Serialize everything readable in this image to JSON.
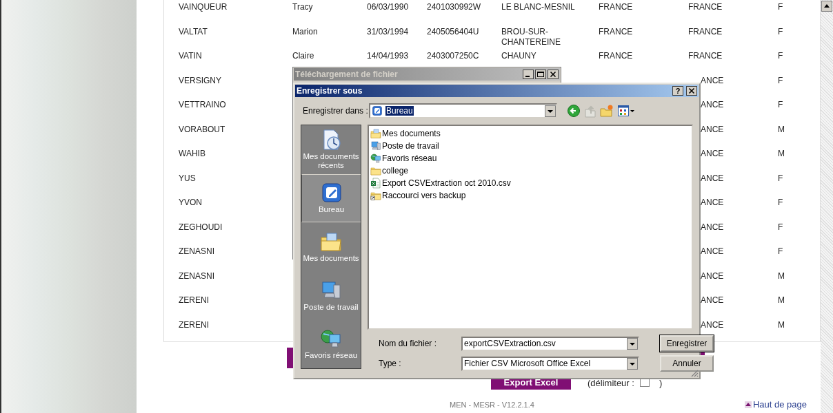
{
  "table": {
    "rows": [
      {
        "kind": "full",
        "cells": [
          "VAINQUEUR",
          "Tracy",
          "06/03/1990",
          "2401030992W",
          "LE BLANC-MESNIL",
          "FRANCE",
          "FRANCE",
          "F"
        ]
      },
      {
        "kind": "full",
        "cells": [
          "VALTAT",
          "Marion",
          "31/03/1994",
          "2405056404U",
          "BROU-SUR-CHANTEREINE",
          "FRANCE",
          "FRANCE",
          "F"
        ]
      },
      {
        "kind": "full",
        "cells": [
          "VATIN",
          "Claire",
          "14/04/1993",
          "2403007250C",
          "CHAUNY",
          "FRANCE",
          "FRANCE",
          "F"
        ]
      },
      {
        "kind": "covered",
        "cells": [
          "VERSIGNY",
          "ANCE",
          "F"
        ]
      },
      {
        "kind": "covered",
        "cells": [
          "VETTRAINO",
          "ANCE",
          "F"
        ]
      },
      {
        "kind": "covered",
        "cells": [
          "VORABOUT",
          "ANCE",
          "M"
        ]
      },
      {
        "kind": "covered",
        "cells": [
          "WAHIB",
          "ANCE",
          "M"
        ]
      },
      {
        "kind": "covered",
        "cells": [
          "YUS",
          "ANCE",
          "F"
        ]
      },
      {
        "kind": "covered",
        "cells": [
          "YVON",
          "ANCE",
          "F"
        ]
      },
      {
        "kind": "covered",
        "cells": [
          "ZEGHOUDI",
          "ANCE",
          "F"
        ]
      },
      {
        "kind": "covered",
        "cells": [
          "ZENASNI",
          "ANCE",
          "F"
        ]
      },
      {
        "kind": "covered",
        "cells": [
          "ZENASNI",
          "ANCE",
          "M"
        ]
      },
      {
        "kind": "covered",
        "cells": [
          "ZERENI",
          "ANCE",
          "M"
        ]
      },
      {
        "kind": "covered",
        "cells": [
          "ZERENI",
          "ANCE",
          "M"
        ]
      }
    ]
  },
  "export_button": "Export Excel",
  "delimiter": {
    "label": "(délimiteur :",
    "close": ")"
  },
  "footer": "MEN - MESR - V12.2.1.4",
  "top_link": "Haut de page",
  "download_window": {
    "title": "Téléchargement de fichier"
  },
  "save_dialog": {
    "title": "Enregistrer sous",
    "help": "?",
    "look_in": {
      "label": "Enregistrer dans :",
      "value": "Bureau"
    },
    "places": [
      {
        "label": "Mes documents récents",
        "kind": "recent",
        "selected": false
      },
      {
        "label": "Bureau",
        "kind": "desktop",
        "selected": true
      },
      {
        "label": "Mes documents",
        "kind": "mydocs",
        "selected": false
      },
      {
        "label": "Poste de travail",
        "kind": "computer",
        "selected": false
      },
      {
        "label": "Favoris réseau",
        "kind": "network",
        "selected": false
      }
    ],
    "files": [
      {
        "name": "Mes documents",
        "kind": "mydocs"
      },
      {
        "name": "Poste de travail",
        "kind": "computer"
      },
      {
        "name": "Favoris réseau",
        "kind": "network"
      },
      {
        "name": "college",
        "kind": "folder"
      },
      {
        "name": "Export CSVExtraction oct 2010.csv",
        "kind": "csv"
      },
      {
        "name": "Raccourci vers backup",
        "kind": "shortcut"
      }
    ],
    "file_name": {
      "label": "Nom du fichier :",
      "value": "exportCSVExtraction.csv"
    },
    "file_type": {
      "label": "Type :",
      "value": "Fichier CSV Microsoft Office Excel"
    },
    "buttons": [
      {
        "label": "Enregistrer",
        "default": true
      },
      {
        "label": "Annuler",
        "default": false
      }
    ]
  }
}
